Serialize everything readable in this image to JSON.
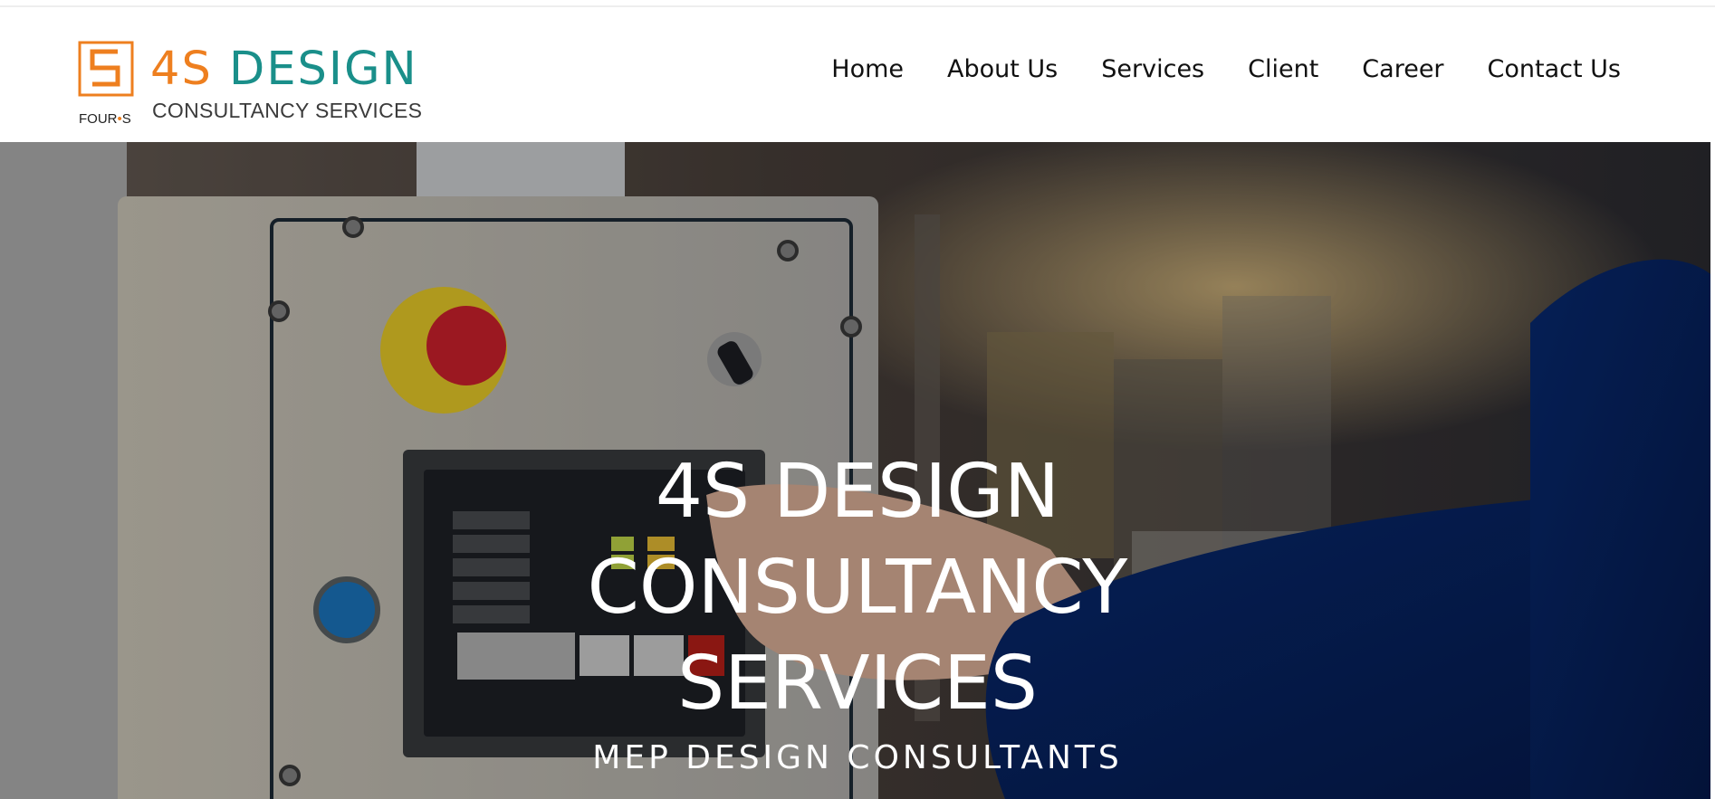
{
  "brand": {
    "logo_main_number": "4S",
    "logo_main_word": "DESIGN",
    "logo_sub": "CONSULTANCY SERVICES",
    "logo_fours_left": "FOUR",
    "logo_fours_dot": "•",
    "logo_fours_right": "S",
    "orange": "#ee7f1f",
    "teal": "#1a8f8a"
  },
  "nav": {
    "items": [
      "Home",
      "About Us",
      "Services",
      "Client",
      "Career",
      "Contact Us"
    ]
  },
  "hero": {
    "title_lines": [
      "4S DESIGN",
      "CONSULTANCY",
      "SERVICES"
    ],
    "subtitle": "MEP DESIGN CONSULTANTS",
    "background_icon": "industrial-control-panel-photo"
  }
}
